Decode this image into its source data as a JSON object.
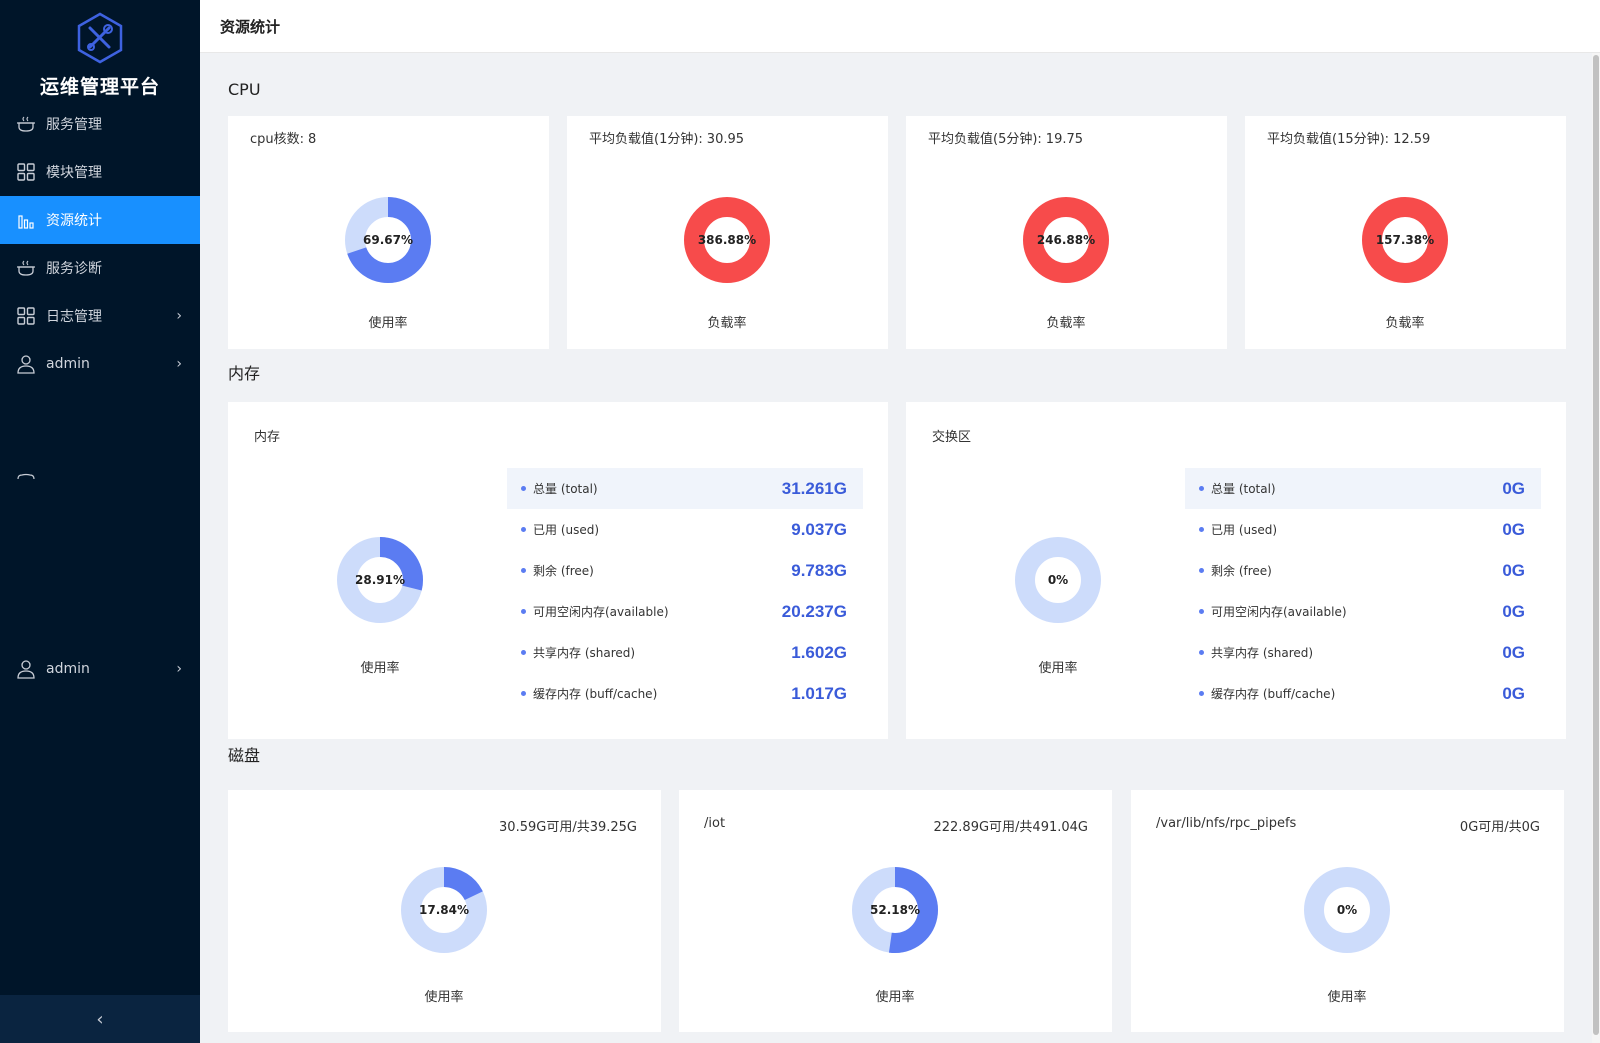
{
  "sidebar": {
    "title": "运维管理平台",
    "items": [
      {
        "label": "服务管理",
        "icon": "cooking-pot-icon"
      },
      {
        "label": "模块管理",
        "icon": "grid-icon"
      },
      {
        "label": "资源统计",
        "icon": "bar-chart-icon",
        "active": true
      },
      {
        "label": "服务诊断",
        "icon": "cooking-pot-icon"
      },
      {
        "label": "日志管理",
        "icon": "grid-icon",
        "arrow": true
      },
      {
        "label": "admin",
        "icon": "user-icon",
        "arrow": true
      }
    ],
    "user2": "admin",
    "collapse": "‹"
  },
  "header": {
    "title": "资源统计"
  },
  "colors": {
    "primary": "#5b7cf2",
    "light": "#cddcfb",
    "danger": "#f74b4b",
    "active_menu": "#1890ff",
    "sidebar_bg": "#001529"
  },
  "sections": {
    "cpu": "CPU",
    "memory": "内存",
    "disk": "磁盘"
  },
  "cpu": [
    {
      "label": "cpu核数:",
      "value": "8",
      "percent": 69.67,
      "pct_text": "69.67%",
      "caption": "使用率",
      "color": "primary"
    },
    {
      "label": "平均负载值(1分钟):",
      "value": "30.95",
      "percent": 386.88,
      "pct_text": "386.88%",
      "caption": "负载率",
      "color": "danger"
    },
    {
      "label": "平均负载值(5分钟):",
      "value": "19.75",
      "percent": 246.88,
      "pct_text": "246.88%",
      "caption": "负载率",
      "color": "danger"
    },
    {
      "label": "平均负载值(15分钟):",
      "value": "12.59",
      "percent": 157.38,
      "pct_text": "157.38%",
      "caption": "负载率",
      "color": "danger"
    }
  ],
  "memory": {
    "title": "内存",
    "percent": 28.91,
    "pct_text": "28.91%",
    "caption": "使用率",
    "stats": [
      {
        "name": "总量 (total)",
        "value": "31.261G"
      },
      {
        "name": "已用 (used)",
        "value": "9.037G"
      },
      {
        "name": "剩余 (free)",
        "value": "9.783G"
      },
      {
        "name": "可用空闲内存(available)",
        "value": "20.237G"
      },
      {
        "name": "共享内存 (shared)",
        "value": "1.602G"
      },
      {
        "name": "缓存内存 (buff/cache)",
        "value": "1.017G"
      }
    ]
  },
  "swap": {
    "title": "交换区",
    "percent": 0,
    "pct_text": "0%",
    "caption": "使用率",
    "stats": [
      {
        "name": "总量 (total)",
        "value": "0G"
      },
      {
        "name": "已用 (used)",
        "value": "0G"
      },
      {
        "name": "剩余 (free)",
        "value": "0G"
      },
      {
        "name": "可用空闲内存(available)",
        "value": "0G"
      },
      {
        "name": "共享内存 (shared)",
        "value": "0G"
      },
      {
        "name": "缓存内存 (buff/cache)",
        "value": "0G"
      }
    ]
  },
  "disks": [
    {
      "mount": "",
      "usage": "30.59G可用/共39.25G",
      "percent": 17.84,
      "pct_text": "17.84%",
      "caption": "使用率"
    },
    {
      "mount": "/iot",
      "usage": "222.89G可用/共491.04G",
      "percent": 52.18,
      "pct_text": "52.18%",
      "caption": "使用率"
    },
    {
      "mount": "/var/lib/nfs/rpc_pipefs",
      "usage": "0G可用/共0G",
      "percent": 0,
      "pct_text": "0%",
      "caption": "使用率"
    }
  ]
}
